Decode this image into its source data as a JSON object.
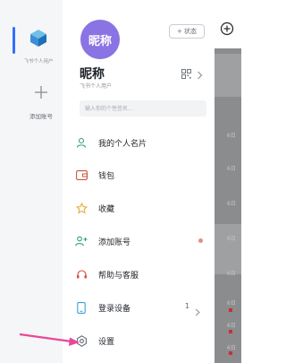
{
  "rail": {
    "account_label": "飞书个人用户",
    "add_account_label": "添加账号"
  },
  "profile": {
    "avatar_text": "昵称",
    "nickname": "昵称",
    "subtitle": "飞书个人用户",
    "status_button": "+ 状态",
    "signature_placeholder": "输入你的个性签名..."
  },
  "menu": [
    {
      "label": "我的个人名片",
      "icon": "person-card-icon"
    },
    {
      "label": "钱包",
      "icon": "wallet-icon"
    },
    {
      "label": "收藏",
      "icon": "star-icon"
    },
    {
      "label": "添加账号",
      "icon": "add-account-icon",
      "badge": true
    },
    {
      "label": "帮助与客服",
      "icon": "headset-icon"
    },
    {
      "label": "登录设备",
      "icon": "phone-icon",
      "count": "1"
    },
    {
      "label": "设置",
      "icon": "gear-icon"
    }
  ],
  "background": {
    "dates": [
      "6日",
      "6日",
      "6日",
      "6日",
      "6日",
      "6日",
      "6日",
      "6日"
    ]
  },
  "colors": {
    "avatar": "#8a73e3",
    "accent": "#3370ff",
    "badge": "#e0917c",
    "arrow": "#e8479a"
  }
}
